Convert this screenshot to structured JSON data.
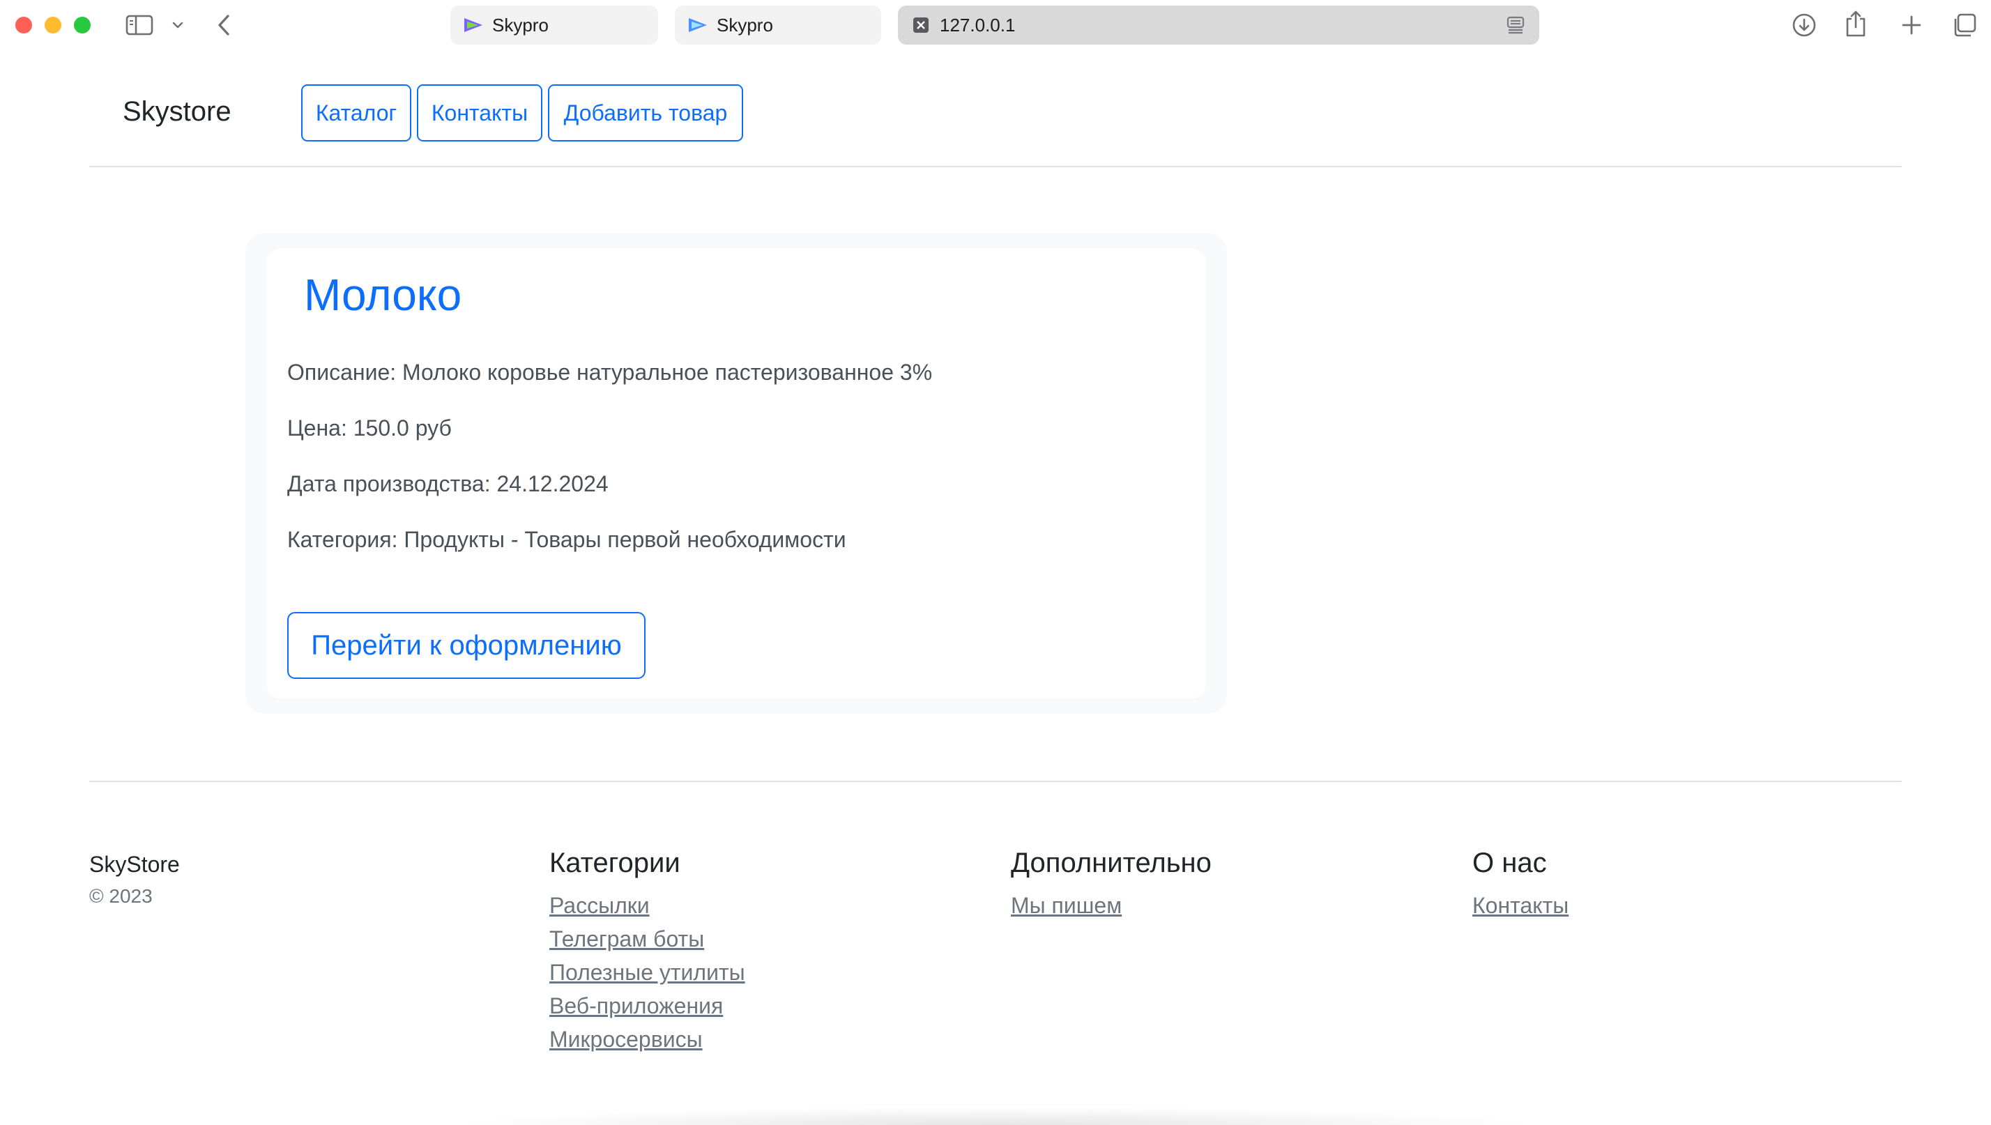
{
  "browser": {
    "tabs": [
      {
        "label": "Skypro",
        "active": false
      },
      {
        "label": "Skypro",
        "active": false
      },
      {
        "label": "127.0.0.1",
        "active": true
      }
    ],
    "icons": {
      "sidebar": "sidebar-icon",
      "chevron": "chevron-down-icon",
      "back": "back-arrow-icon",
      "download": "download-icon",
      "share": "share-icon",
      "new_tab": "plus-icon",
      "tabs_overview": "tabs-overview-icon"
    }
  },
  "header": {
    "brand": "Skystore",
    "nav": [
      {
        "label": "Каталог"
      },
      {
        "label": "Контакты"
      },
      {
        "label": "Добавить товар"
      }
    ]
  },
  "product": {
    "title": "Молоко",
    "description": "Описание: Молоко коровье натуральное пастеризованное 3%",
    "price": "Цена: 150.0 руб",
    "production_date": "Дата производства: 24.12.2024",
    "category": "Категория: Продукты - Товары первой необходимости",
    "checkout_label": "Перейти к оформлению"
  },
  "footer": {
    "brand": "SkyStore",
    "copyright": "© 2023",
    "columns": [
      {
        "title": "Категории",
        "links": [
          "Рассылки",
          "Телеграм боты",
          "Полезные утилиты",
          "Веб-приложения",
          "Микросервисы"
        ]
      },
      {
        "title": "Дополнительно",
        "links": [
          "Мы пишем"
        ]
      },
      {
        "title": "О нас",
        "links": [
          "Контакты"
        ]
      }
    ]
  },
  "colors": {
    "primary": "#0d6efd",
    "card_bg": "#f8f9fa",
    "muted": "#6c757d"
  }
}
